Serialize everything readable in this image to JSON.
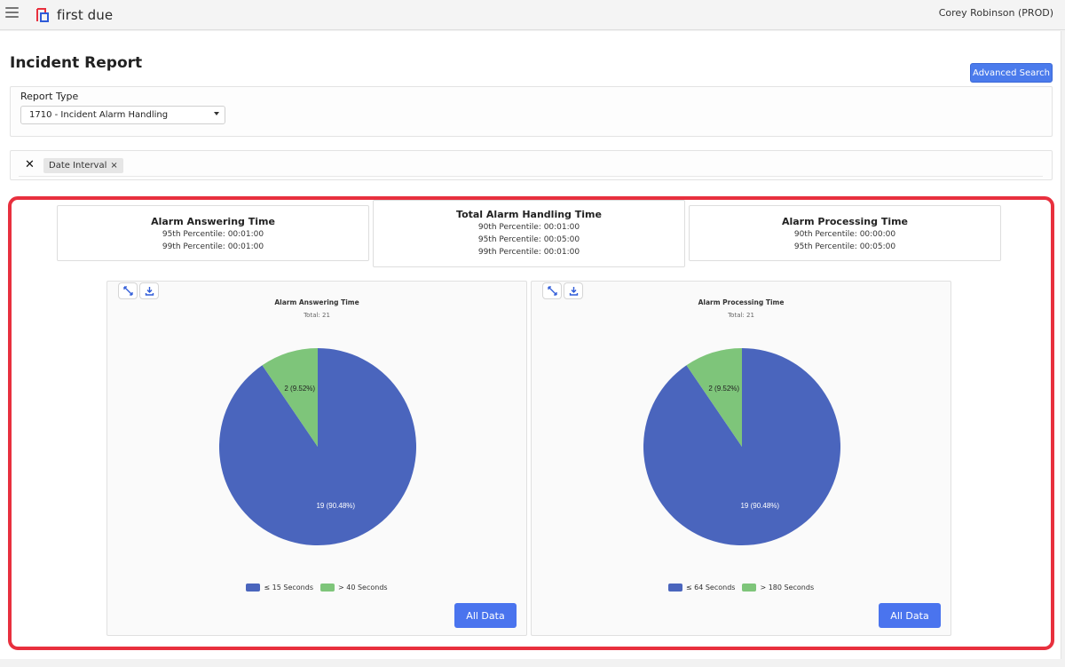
{
  "header": {
    "logo_text": "first due",
    "user": "Corey Robinson (PROD)"
  },
  "page": {
    "title": "Incident Report",
    "advanced_search_label": "Advanced Search"
  },
  "report_type": {
    "label": "Report Type",
    "selected": "1710 - Incident Alarm Handling"
  },
  "filters": {
    "clear_label": "✕",
    "chips": [
      {
        "label": "Date Interval",
        "remove": "×"
      }
    ]
  },
  "stats": [
    {
      "title": "Alarm Answering Time",
      "lines": [
        "95th Percentile: 00:01:00",
        "99th Percentile: 00:01:00"
      ]
    },
    {
      "title": "Total Alarm Handling Time",
      "lines": [
        "90th Percentile: 00:01:00",
        "95th Percentile: 00:05:00",
        "99th Percentile: 00:01:00"
      ]
    },
    {
      "title": "Alarm Processing Time",
      "lines": [
        "90th Percentile: 00:00:00",
        "95th Percentile: 00:05:00"
      ]
    }
  ],
  "colors": {
    "series_a": "#4a65bd",
    "series_b": "#7ec57a",
    "accent": "#4a74ee",
    "highlight": "#e8303e"
  },
  "chart_data": [
    {
      "type": "pie",
      "title": "Alarm Answering Time",
      "subtitle": "Total: 21",
      "slices": [
        {
          "label": "≤ 15 Seconds",
          "value": 19,
          "display": "19 (90.48%)"
        },
        {
          "label": "> 40 Seconds",
          "value": 2,
          "display": "2 (9.52%)"
        }
      ],
      "legend": "bottom",
      "button_label": "All Data"
    },
    {
      "type": "pie",
      "title": "Alarm Processing Time",
      "subtitle": "Total: 21",
      "slices": [
        {
          "label": "≤ 64 Seconds",
          "value": 19,
          "display": "19 (90.48%)"
        },
        {
          "label": "> 180 Seconds",
          "value": 2,
          "display": "2 (9.52%)"
        }
      ],
      "legend": "bottom",
      "button_label": "All Data"
    }
  ]
}
